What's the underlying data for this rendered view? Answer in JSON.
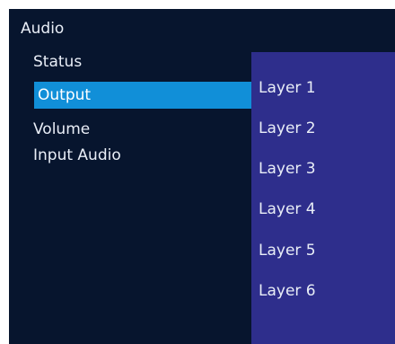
{
  "menu": {
    "title": "Audio",
    "items": [
      {
        "label": "Status"
      },
      {
        "label": "Output",
        "selected": true
      },
      {
        "label": "Volume"
      },
      {
        "label": "Input Audio"
      }
    ]
  },
  "submenu": {
    "items": [
      {
        "label": "Layer 1"
      },
      {
        "label": "Layer 2"
      },
      {
        "label": "Layer 3"
      },
      {
        "label": "Layer 4"
      },
      {
        "label": "Layer 5"
      },
      {
        "label": "Layer 6"
      }
    ]
  },
  "colors": {
    "background": "#07152e",
    "selection": "#118fd8",
    "submenu_background": "#2e2e8c",
    "text": "#e9eef7"
  }
}
